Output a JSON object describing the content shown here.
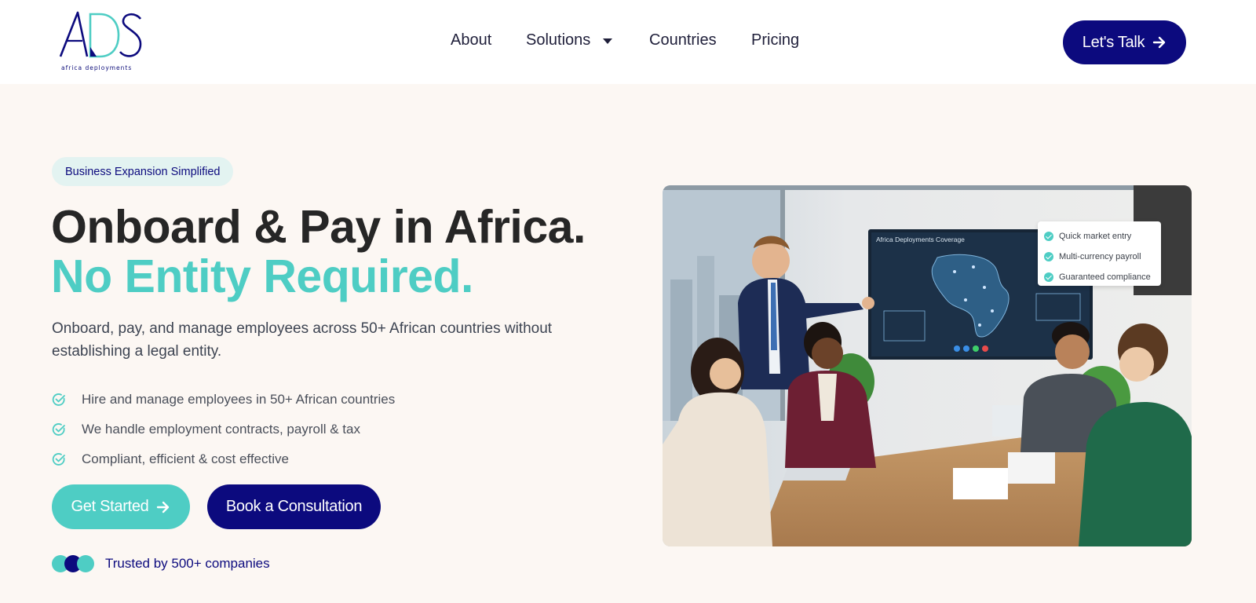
{
  "brand": {
    "logo_text": "ADS",
    "tagline": "africa deployments",
    "colors": {
      "navy": "#0c0a7e",
      "teal": "#4ecdc4",
      "background": "#fcf7f3"
    }
  },
  "nav": {
    "items": [
      {
        "label": "About"
      },
      {
        "label": "Solutions",
        "icon": "chevron-down-icon"
      },
      {
        "label": "Countries"
      },
      {
        "label": "Pricing"
      }
    ],
    "cta_label": "Let's Talk"
  },
  "hero": {
    "badge": "Business Expansion Simplified",
    "title_line1": "Onboard & Pay in Africa.",
    "title_line2": "No Entity Required.",
    "lead": "Onboard, pay, and manage employees across 50+ African countries without establishing a legal entity.",
    "features": [
      "Hire and manage employees in 50+ African countries",
      "We handle employment contracts, payroll & tax",
      "Compliant, efficient & cost effective"
    ],
    "primary_cta": "Get Started",
    "secondary_cta": "Book a Consultation",
    "trusted_text": "Trusted by 500+ companies"
  },
  "hero_image": {
    "screen_title": "Africa Deployments Coverage",
    "callouts": [
      "Quick market entry",
      "Multi-currency payroll",
      "Guaranteed compliance"
    ]
  }
}
